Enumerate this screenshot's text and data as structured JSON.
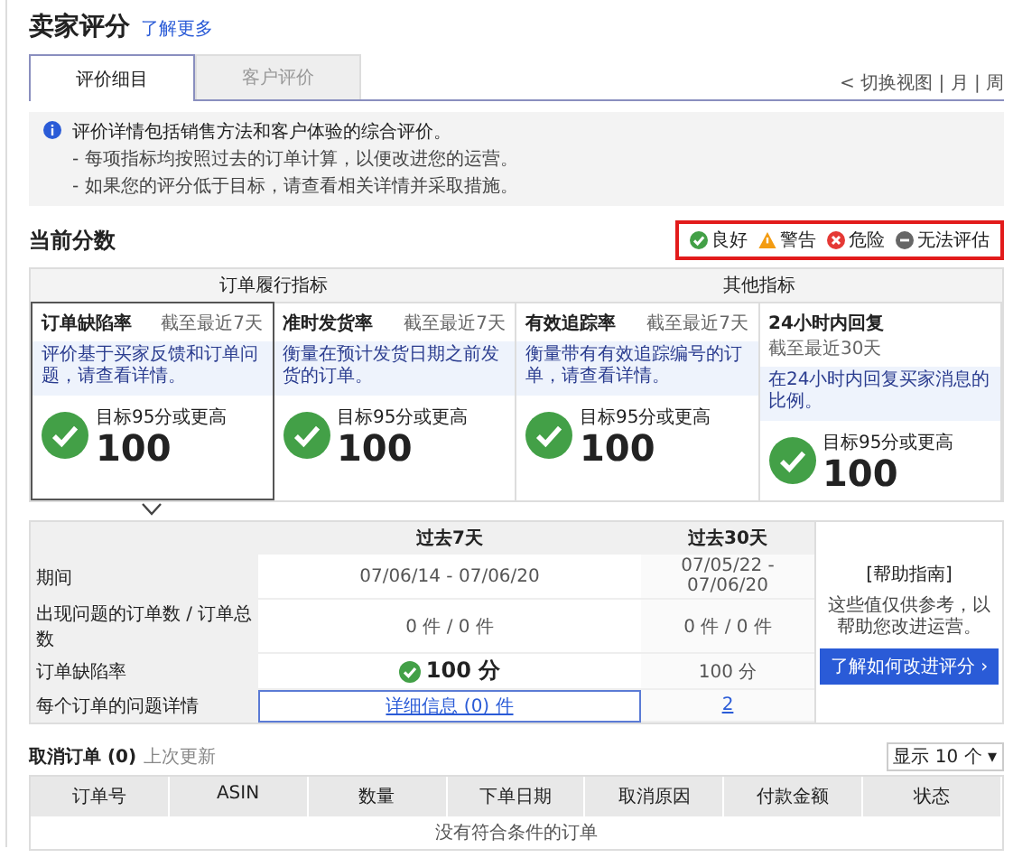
{
  "header": {
    "title": "卖家评分",
    "link": "了解更多"
  },
  "tabs": [
    {
      "label": "评价细目",
      "selected": true
    },
    {
      "label": "客户评价",
      "selected": false
    }
  ],
  "view_switch": "< 切换视图 | 月 | 周",
  "info": {
    "title": "评价详情包括销售方法和客户体验的综合评价。",
    "bullets": [
      "- 每项指标均按照过去的订单计算，以便改进您的运营。",
      "- 如果您的评分低于目标，请查看相关详情并采取措施。"
    ]
  },
  "current": {
    "title": "当前分数",
    "legend": [
      {
        "label": "良好",
        "kind": "good",
        "color": "#43a047"
      },
      {
        "label": "警告",
        "kind": "warning",
        "color": "#f39c12"
      },
      {
        "label": "危险",
        "kind": "danger",
        "color": "#e53935"
      },
      {
        "label": "无法评估",
        "kind": "none",
        "color": "#666666"
      }
    ],
    "groups": [
      {
        "label": "订单履行指标"
      },
      {
        "label": "其他指标"
      }
    ],
    "cards": [
      {
        "title": "订单缺陷率",
        "period": "截至最近7天",
        "description": "评价基于买家反馈和订单问题，请查看详情。",
        "score_label": "目标95分或更高",
        "score": "100",
        "kind": "good",
        "selected": true
      },
      {
        "title": "准时发货率",
        "period": "截至最近7天",
        "description": "衡量在预计发货日期之前发货的订单。",
        "score_label": "目标95分或更高",
        "score": "100",
        "kind": "good",
        "selected": false
      },
      {
        "title": "有效追踪率",
        "period": "截至最近7天",
        "description": "衡量带有有效追踪编号的订单，请查看详情。",
        "score_label": "目标95分或更高",
        "score": "100",
        "kind": "good",
        "selected": false
      },
      {
        "title": "24小时内回复",
        "period": "截至最近30天",
        "description": "在24小时内回复买家消息的比例。",
        "score_label": "目标95分或更高",
        "score": "100",
        "kind": "good",
        "selected": false
      }
    ]
  },
  "summary": {
    "columns": [
      "过去7天",
      "过去30天"
    ],
    "rows": [
      {
        "label": "期间",
        "kind": "text",
        "values": [
          "07/06/14 - 07/06/20",
          "07/05/22 - 07/06/20"
        ]
      },
      {
        "label": "出现问题的订单数 / 订单总数",
        "kind": "text",
        "values": [
          "0 件 / 0 件",
          "0 件 / 0 件"
        ]
      },
      {
        "label": "订单缺陷率",
        "kind": "score",
        "values": [
          "100 分",
          "100 分"
        ]
      },
      {
        "label": "每个订单的问题详情",
        "kind": "link",
        "values": [
          "详细信息 (0) 件",
          "2"
        ]
      }
    ],
    "help": {
      "title": "[帮助指南]",
      "text": "这些值仅供参考，以帮助您改进运营。",
      "button": "了解如何改进评分 ›"
    }
  },
  "cancellations": {
    "title": "取消订单 (0)",
    "updated": "上次更新",
    "page_size": "显示 10 个 ▾",
    "columns": [
      "订单号",
      "ASIN",
      "数量",
      "下单日期",
      "取消原因",
      "付款金额",
      "状态"
    ],
    "empty": "没有符合条件的订单"
  }
}
